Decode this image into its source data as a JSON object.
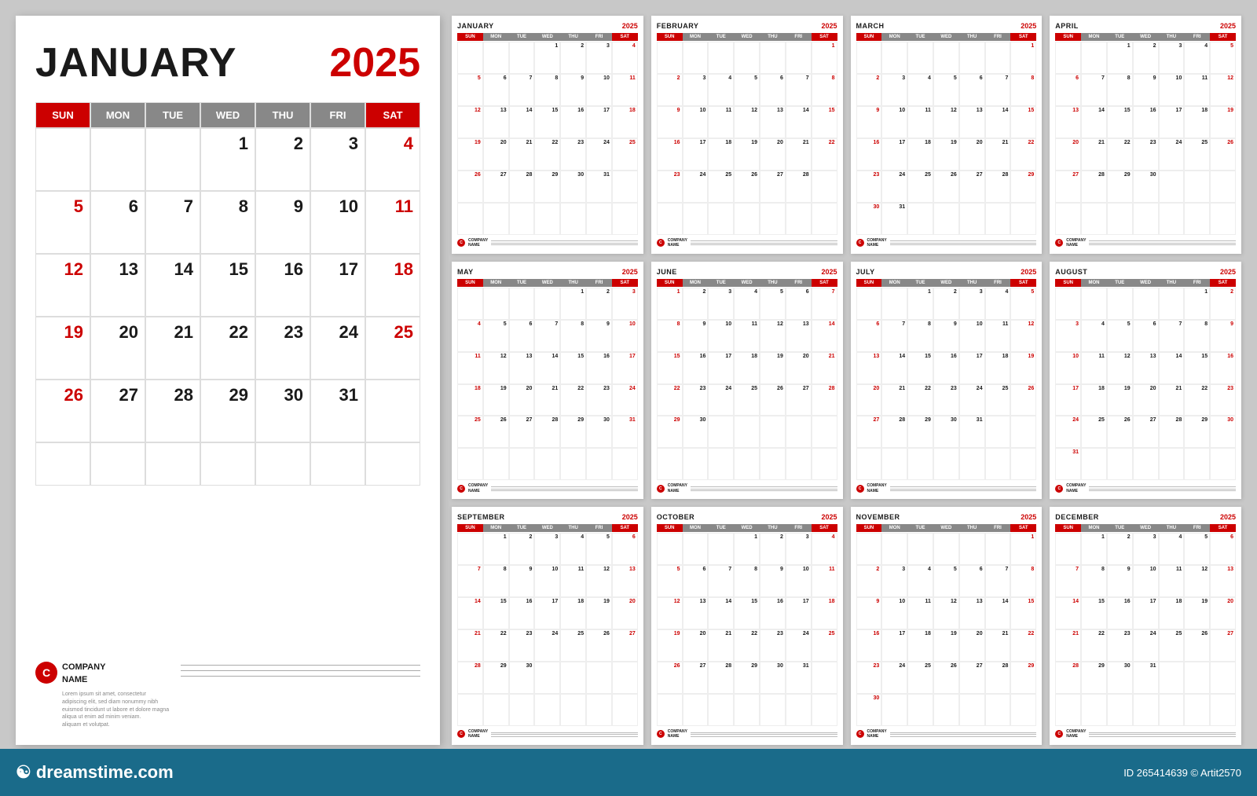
{
  "brand": {
    "dreamstime_text": "dreamstime.com",
    "image_id": "265414639",
    "author": "Artit2570"
  },
  "large_calendar": {
    "month": "JANUARY",
    "year": "2025",
    "days": [
      "SUN",
      "MON",
      "TUE",
      "WED",
      "THU",
      "FRI",
      "SAT"
    ],
    "company_name": "COMPANY\nNAME",
    "company_logo_letter": "C",
    "company_desc": "Lorem ipsum sit amet, consectetur\nadipiscing elit, sed diam nonummy nibh\neuismod tincidunt ut labore et dolore magna\naliqua ut enim ad minim veniam.\naliquam et volutpat."
  },
  "months": [
    {
      "name": "JANUARY",
      "year": "2025",
      "start": 3,
      "days": 31
    },
    {
      "name": "FEBRUARY",
      "year": "2025",
      "start": 6,
      "days": 28
    },
    {
      "name": "MARCH",
      "year": "2025",
      "start": 6,
      "days": 31
    },
    {
      "name": "APRIL",
      "year": "2025",
      "start": 2,
      "days": 30
    },
    {
      "name": "MAY",
      "year": "2025",
      "start": 4,
      "days": 31
    },
    {
      "name": "JUNE",
      "year": "2025",
      "start": 0,
      "days": 30
    },
    {
      "name": "JULY",
      "year": "2025",
      "start": 2,
      "days": 31
    },
    {
      "name": "AUGUST",
      "year": "2025",
      "start": 5,
      "days": 31
    },
    {
      "name": "SEPTEMBER",
      "year": "2025",
      "start": 1,
      "days": 30
    },
    {
      "name": "OCTOBER",
      "year": "2025",
      "start": 3,
      "days": 31
    },
    {
      "name": "NOVEMBER",
      "year": "2025",
      "start": 6,
      "days": 30
    },
    {
      "name": "DECEMBER",
      "year": "2025",
      "start": 1,
      "days": 31
    }
  ]
}
